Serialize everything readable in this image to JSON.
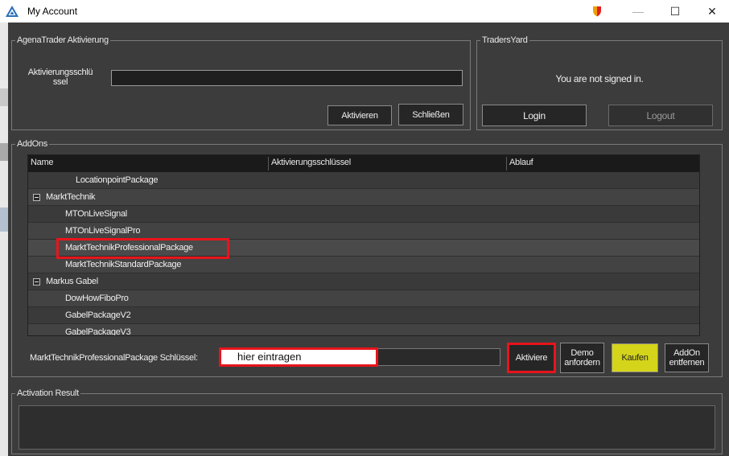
{
  "window": {
    "title": "My Account",
    "minimize": "—",
    "maximize": "☐",
    "close": "✕"
  },
  "activation": {
    "legend": "AgenaTrader Aktivierung",
    "key_label_line1": "Aktivierungsschlü",
    "key_label_line2": "ssel",
    "key_value": "",
    "activate_button": "Aktivieren",
    "close_button": "Schließen"
  },
  "tradersyard": {
    "legend": "TradersYard",
    "status": "You are not signed in.",
    "login_button": "Login",
    "logout_button": "Logout"
  },
  "addons": {
    "legend": "AddOns",
    "columns": [
      "Name",
      "Aktivierungsschlüssel",
      "Ablauf"
    ],
    "rows": [
      {
        "name": "LocationpointPackage",
        "type": "child2"
      },
      {
        "name": "MarktTechnik",
        "type": "group"
      },
      {
        "name": "MTOnLiveSignal",
        "type": "child"
      },
      {
        "name": "MTOnLiveSignalPro",
        "type": "child"
      },
      {
        "name": "MarktTechnikProfessionalPackage",
        "type": "child",
        "selected": true
      },
      {
        "name": "MarktTechnikStandardPackage",
        "type": "child"
      },
      {
        "name": "Markus Gabel",
        "type": "group"
      },
      {
        "name": "DowHowFiboPro",
        "type": "child"
      },
      {
        "name": "GabelPackageV2",
        "type": "child"
      },
      {
        "name": "GabelPackageV3",
        "type": "child"
      }
    ],
    "key_label": "MarktTechnikProfessionalPackage Schlüssel:",
    "key_input_annotation": "hier eintragen",
    "activate_button": "Aktiviere",
    "demo_button_line1": "Demo",
    "demo_button_line2": "anfordern",
    "buy_button": "Kaufen",
    "remove_button_line1": "AddOn",
    "remove_button_line2": "entfernen"
  },
  "result": {
    "legend": "Activation Result",
    "text": ""
  },
  "colors": {
    "highlight": "#e8141c",
    "buy": "#d4d41a",
    "background": "#3c3c3c"
  }
}
